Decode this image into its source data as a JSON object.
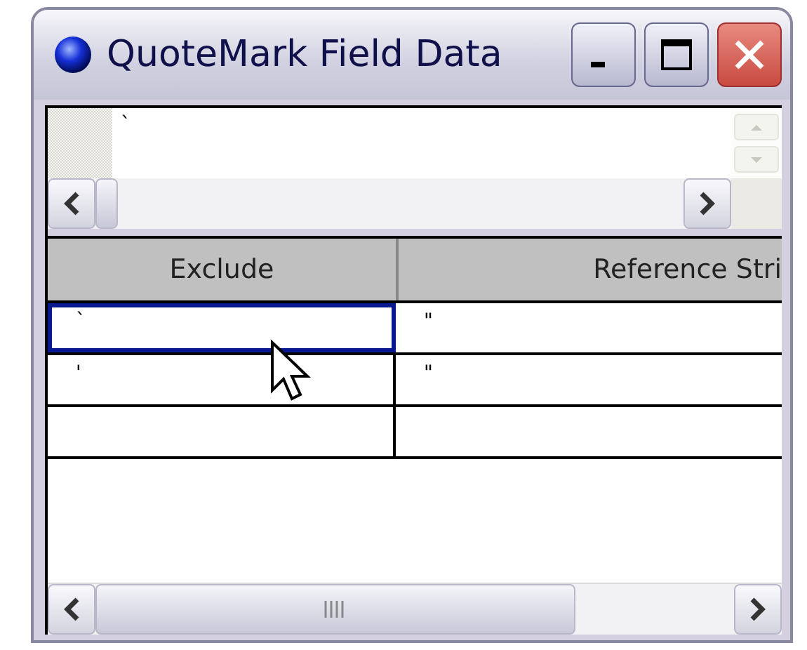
{
  "window": {
    "title": "QuoteMark Field Data"
  },
  "top_field": {
    "value": "`"
  },
  "grid": {
    "columns": [
      "Exclude",
      "Reference Stri"
    ],
    "rows": [
      {
        "cells": [
          {
            "text": "`",
            "selected": true
          },
          {
            "text": "\"",
            "selected": false
          }
        ]
      },
      {
        "cells": [
          {
            "text": "'",
            "selected": false
          },
          {
            "text": "\"",
            "selected": false
          }
        ]
      }
    ]
  }
}
